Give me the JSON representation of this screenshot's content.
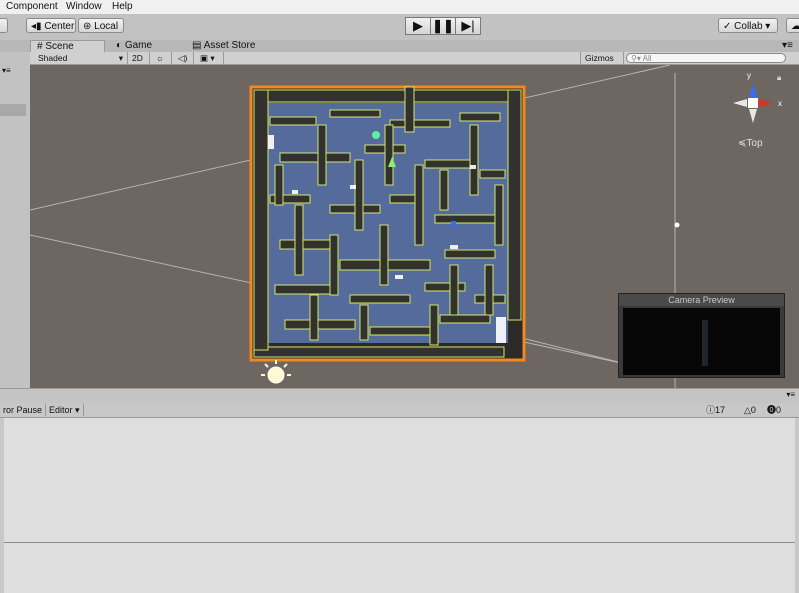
{
  "menu": [
    "Component",
    "Window",
    "Help"
  ],
  "toolbar": {
    "pivot_label": "Center",
    "space_label": "Local",
    "collab_label": "Collab ▾"
  },
  "tabs": {
    "scene": "Scene",
    "game": "Game",
    "asset_store": "Asset Store"
  },
  "scene_toolbar": {
    "shading": "Shaded",
    "mode_2d": "2D",
    "gizmos": "Gizmos",
    "search_placeholder": "All"
  },
  "gizmo": {
    "axis_y": "y",
    "axis_x": "x",
    "view_label": "Top"
  },
  "camera_preview": {
    "title": "Camera Preview"
  },
  "console": {
    "error_pause": "ror Pause",
    "editor": "Editor ▾",
    "log_count": "17",
    "warn_count": "0",
    "error_count": "0"
  },
  "colors": {
    "maze_outline": "#f08a20",
    "scene_bg": "#6e6660",
    "cell_outline": "#cfe870",
    "floor": "#5a72a8"
  }
}
